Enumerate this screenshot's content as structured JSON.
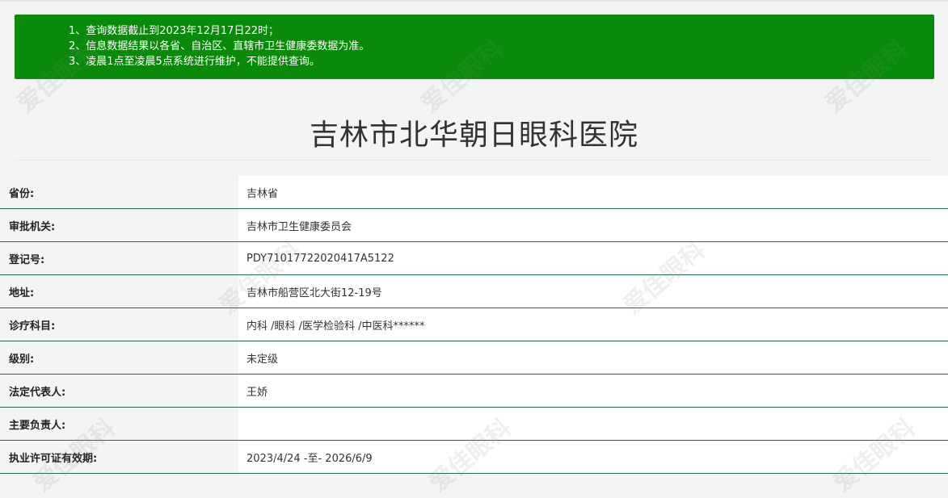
{
  "notice": {
    "lines": [
      "1、查询数据截止到2023年12月17日22时；",
      "2、信息数据结果以各省、自治区、直辖市卫生健康委数据为准。",
      "3、凌晨1点至凌晨5点系统进行维护，不能提供查询。"
    ],
    "background_color": "#0a8a0a"
  },
  "hospital": {
    "name": "吉林市北华朝日眼科医院"
  },
  "fields": [
    {
      "label": "省份:",
      "value": "吉林省"
    },
    {
      "label": "审批机关:",
      "value": "吉林市卫生健康委员会"
    },
    {
      "label": "登记号:",
      "value": "PDY71017722020417A5122"
    },
    {
      "label": "地址:",
      "value": "吉林市船营区北大街12-19号"
    },
    {
      "label": "诊疗科目:",
      "value": "内科 /眼科 /医学检验科 /中医科******"
    },
    {
      "label": "级别:",
      "value": "未定级"
    },
    {
      "label": "法定代表人:",
      "value": "王娇"
    },
    {
      "label": "主要负责人:",
      "value": ""
    },
    {
      "label": "执业许可证有效期:",
      "value": "2023/4/24 -至- 2026/6/9"
    }
  ],
  "watermark": {
    "text": "爱佳眼科"
  }
}
